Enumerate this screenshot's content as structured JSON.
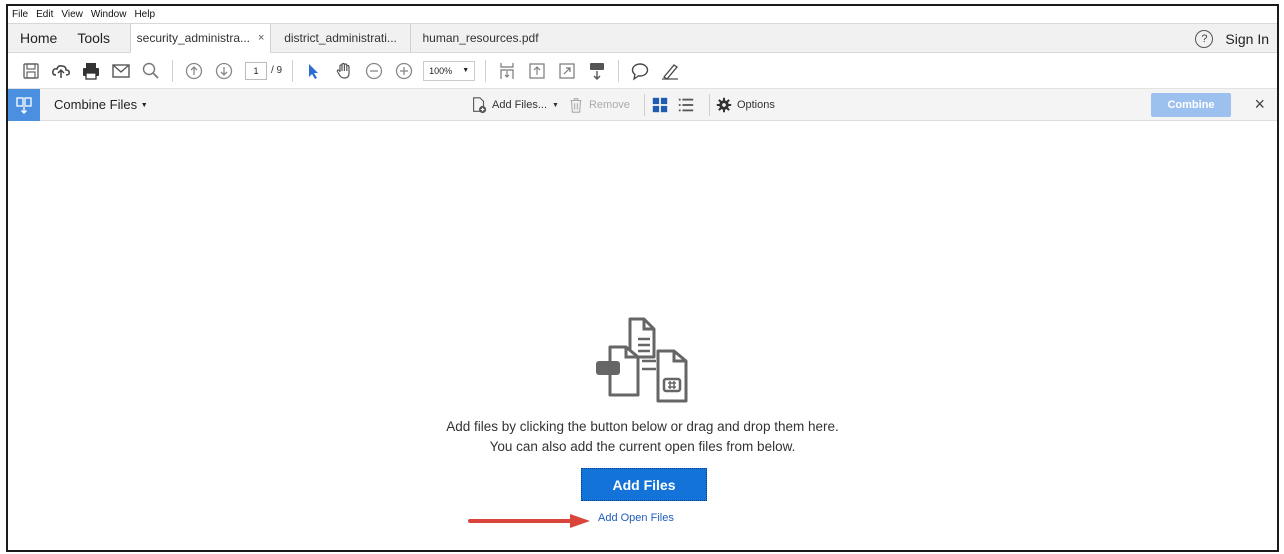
{
  "menu": [
    "File",
    "Edit",
    "View",
    "Window",
    "Help"
  ],
  "tabs": {
    "home": "Home",
    "tools": "Tools",
    "documents": [
      {
        "label": "security_administra...",
        "close": "×"
      },
      {
        "label": "district_administrati..."
      },
      {
        "label": "human_resources.pdf"
      }
    ],
    "help": "?",
    "sign_in": "Sign In"
  },
  "toolbar": {
    "page_current": "1",
    "page_total": "/ 9",
    "zoom": "100%"
  },
  "combine": {
    "title": "Combine Files",
    "add_files": "Add Files...",
    "remove": "Remove",
    "options": "Options",
    "combine_button": "Combine",
    "close": "×"
  },
  "content": {
    "line1": "Add files by clicking the button below or drag and drop them here.",
    "line2": "You can also add the current open files from below.",
    "add_files_button": "Add Files",
    "add_open_files": "Add Open Files"
  },
  "colors": {
    "accent": "#1473d9",
    "combine_disabled": "#9cc1ee",
    "arrow": "#d9453b"
  }
}
